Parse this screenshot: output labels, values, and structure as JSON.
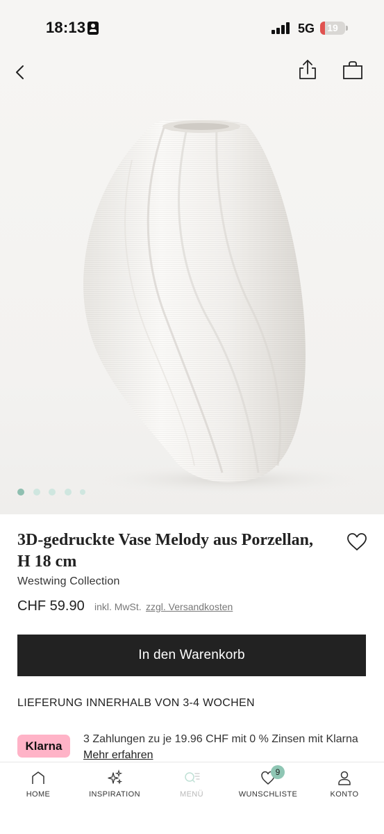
{
  "status_bar": {
    "time": "18:13",
    "network": "5G",
    "battery_level": "19",
    "battery_color": "#e0524f"
  },
  "image_nav": {
    "back_icon": "chevron-left-icon",
    "share_icon": "share-icon",
    "bag_icon": "shopping-bag-icon"
  },
  "gallery": {
    "image_count": 5,
    "active_index": 0,
    "dot_active_color": "#8fbfb0",
    "dot_inactive_color": "#cfe6df"
  },
  "product": {
    "title": "3D-gedruckte Vase Melody aus Porzellan, H 18 cm",
    "brand": "Westwing Collection",
    "price": "CHF 59.90",
    "tax_note": "inkl. MwSt.",
    "shipping_link": "zzgl. Versandkosten",
    "wishlist_icon": "heart-icon"
  },
  "actions": {
    "add_to_cart": "In den Warenkorb"
  },
  "delivery": {
    "text": "LIEFERUNG INNERHALB VON 3-4 WOCHEN"
  },
  "klarna": {
    "badge": "Klarna",
    "text": "3 Zahlungen zu je 19.96 CHF mit 0 % Zinsen mit Klarna",
    "link": "Mehr erfahren",
    "badge_color": "#ffb3c7"
  },
  "tab_bar": {
    "home": "HOME",
    "inspiration": "INSPIRATION",
    "menu": "MENÜ",
    "wishlist": "WUNSCHLISTE",
    "wishlist_count": "9",
    "account": "KONTO",
    "accent_color": "#8fc6b4"
  }
}
